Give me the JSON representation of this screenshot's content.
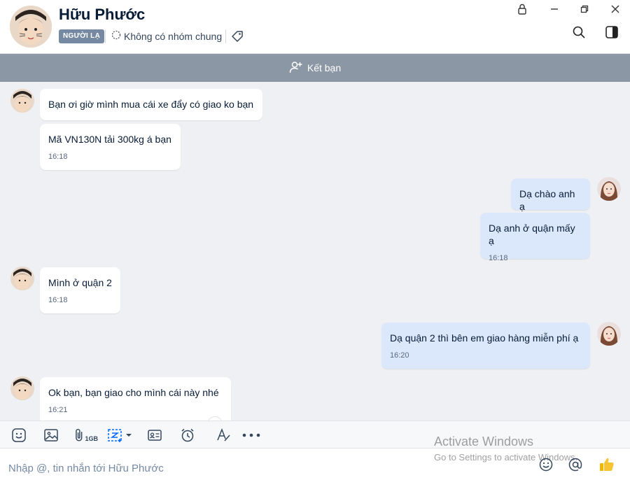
{
  "header": {
    "contact_name": "Hữu Phước",
    "stranger_badge": "NGƯỜI LẠ",
    "common_groups": "Không có nhóm chung"
  },
  "friend_bar": {
    "label": "Kết bạn"
  },
  "messages": [
    {
      "side": "in",
      "text": "Bạn ơi giờ mình mua cái xe đẩy có giao ko bạn",
      "time": ""
    },
    {
      "side": "in",
      "text": "Mã VN130N tải 300kg á bạn",
      "time": "16:18"
    },
    {
      "side": "out",
      "text": "Dạ chào anh ạ",
      "time": ""
    },
    {
      "side": "out",
      "text": "Dạ anh ở quận mấy ạ",
      "time": "16:18"
    },
    {
      "side": "in",
      "text": "Mình ở quận 2",
      "time": "16:18"
    },
    {
      "side": "out",
      "text": "Dạ quận 2 thì bên em giao hàng miễn phí ạ",
      "time": "16:20"
    },
    {
      "side": "in",
      "text": "Ok bạn, bạn giao cho mình cái này nhé",
      "time": "16:21"
    }
  ],
  "toolbar": {
    "file_size_label": "1GB"
  },
  "composer": {
    "placeholder": "Nhập @, tin nhắn tới Hữu Phước"
  },
  "watermark": {
    "line1": "Activate Windows",
    "line2": "Go to Settings to activate Windows."
  },
  "colors": {
    "accent": "#0068ff",
    "outgoing_bubble": "#dbe7fb",
    "incoming_bubble": "#ffffff",
    "friend_bar": "#8c97a5",
    "badge": "#7589a3"
  }
}
